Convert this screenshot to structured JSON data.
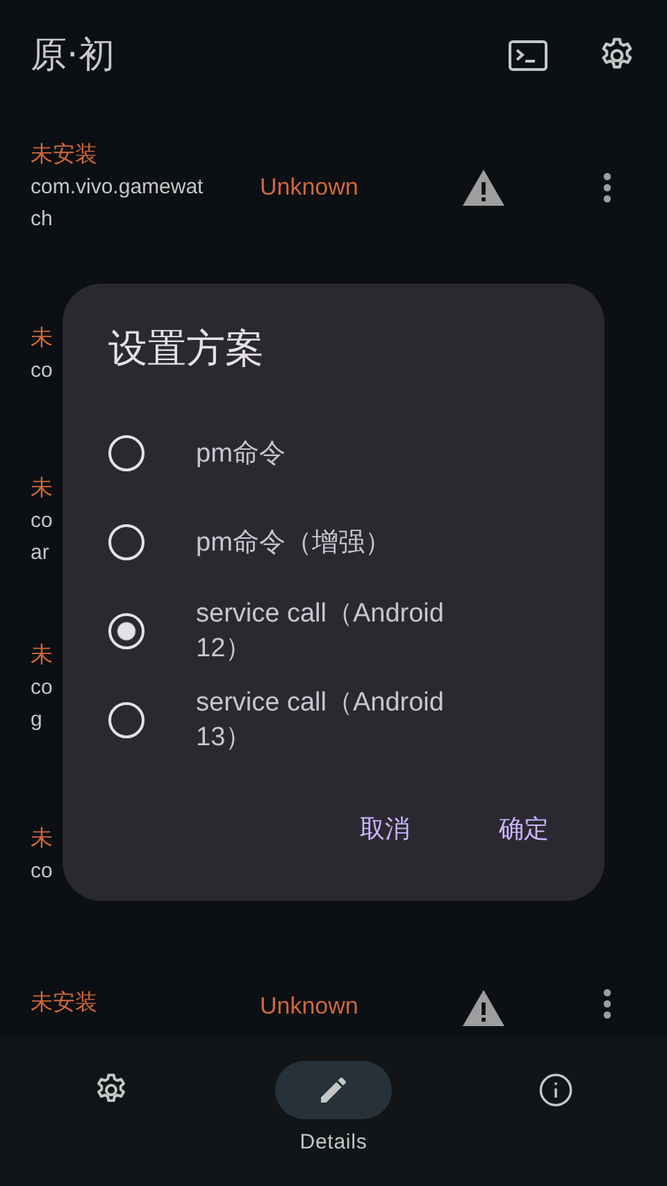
{
  "app_bar": {
    "title": "原·初"
  },
  "rows": [
    {
      "status": "未安装",
      "package": "com.vivo.gamewat ch",
      "state": "Unknown"
    },
    {
      "status": "未",
      "package": "co"
    },
    {
      "status": "未",
      "package": "co ar"
    },
    {
      "status": "未",
      "package": "co g"
    },
    {
      "status": "未",
      "package": "co"
    },
    {
      "status": "未安装",
      "state": "Unknown"
    }
  ],
  "dialog": {
    "title": "设置方案",
    "options": [
      {
        "label": "pm命令",
        "selected": false
      },
      {
        "label": "pm命令（增强）",
        "selected": false
      },
      {
        "label": "service call（Android 12）",
        "selected": true
      },
      {
        "label": "service call（Android 13）",
        "selected": false
      }
    ],
    "buttons": [
      "取消",
      "确定"
    ]
  },
  "bottom_nav": [
    {
      "kind": "settings",
      "selected": false
    },
    {
      "kind": "details",
      "label": "Details",
      "selected": true
    },
    {
      "kind": "info",
      "selected": false
    }
  ]
}
